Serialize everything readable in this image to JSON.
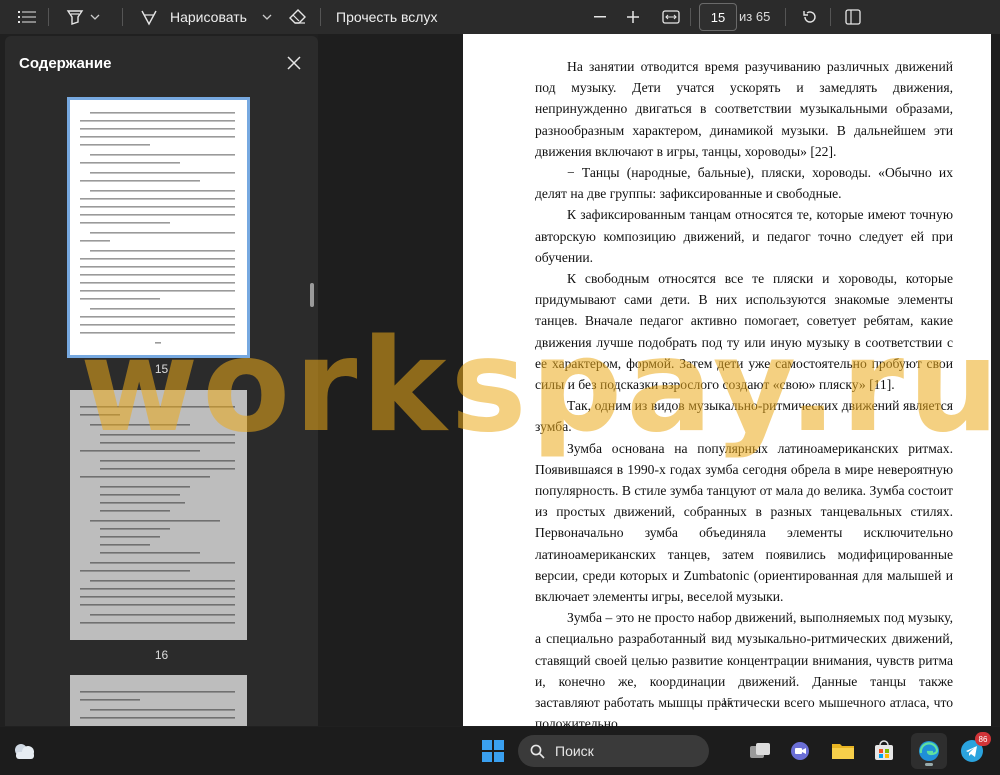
{
  "toolbar": {
    "draw_label": "Нарисовать",
    "read_aloud_label": "Прочесть вслух",
    "page_current": "15",
    "page_total": "из 65"
  },
  "sidebar": {
    "title": "Содержание",
    "thumbnails": [
      {
        "label": "15"
      },
      {
        "label": "16"
      }
    ]
  },
  "document": {
    "page_number": "15",
    "paragraphs": [
      "На занятии отводится время разучиванию различных движений под музыку. Дети учатся ускорять и замедлять движения, непринужденно двигаться в соответствии музыкальными образами, разнообразным характером, динамикой музыки. В дальнейшем эти движения включают в игры, танцы, хороводы» [22].",
      "−      Танцы (народные, бальные), пляски, хороводы. «Обычно их делят на две группы: зафиксированные и свободные.",
      "К зафиксированным танцам относятся те, которые имеют точную авторскую композицию движений, и педагог точно следует ей при обучении.",
      "К свободным относятся все те пляски и хороводы, которые придумывают сами дети. В них используются знакомые элементы танцев. Вначале педагог активно помогает, советует ребятам, какие движения лучше подобрать под ту или иную музыку в соответствии с ее характером, формой. Затем дети уже самостоятельно пробуют свои силы и без подсказки взрослого создают «свою» пляску» [11].",
      "Так, одним из видов музыкально-ритмических движений является зумба.",
      "Зумба основана на популярных латиноамериканских ритмах. Появившаяся в 1990-х годах зумба сегодня обрела в мире невероятную популярность. В стиле зумба танцуют от мала до велика. Зумба состоит из простых движений, собранных в разных танцевальных стилях. Первоначально зумба объединяла элементы исключительно латиноамериканских танцев, затем появились модифицированные версии, среди которых и Zumbatonic (ориентированная для малышей и включает элементы игры, веселой музыки.",
      "Зумба – это не просто набор движений, выполняемых под музыку, а специально разработанный вид музыкально-ритмических движений, ставящий своей целью развитие концентрации внимания, чувств ритма и, конечно же, координации движений. Данные танцы также заставляют работать мышцы практически всего мышечного атласа, что положительно"
    ]
  },
  "watermark": "workspay.ru",
  "taskbar": {
    "search_label": "Поиск",
    "telegram_badge": "86"
  },
  "colors": {
    "accent": "#77a9e0",
    "watermark": "#ebaa19",
    "toolbar_bg": "#2b2b2b",
    "doc_bg": "#1e1e1e"
  }
}
